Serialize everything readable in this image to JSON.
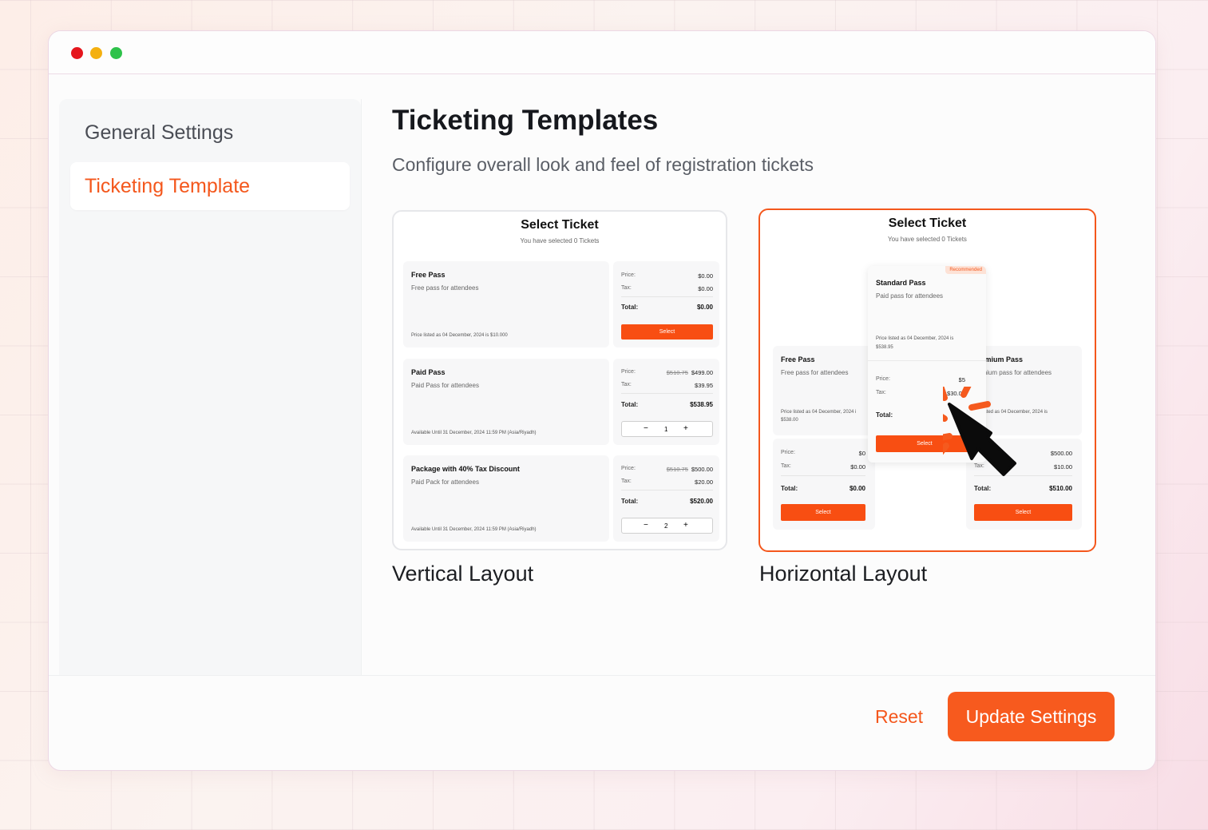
{
  "colors": {
    "accent": "#f4571c",
    "button": "#f75a1e",
    "active_text": "#f4571c"
  },
  "window": {
    "controls": [
      "close",
      "minimize",
      "maximize"
    ]
  },
  "sidebar": {
    "items": [
      {
        "label": "General Settings",
        "active": false
      },
      {
        "label": "Ticketing Template",
        "active": true
      }
    ]
  },
  "main": {
    "title": "Ticketing Templates",
    "subtitle": "Configure overall look and feel of registration tickets"
  },
  "templates": [
    {
      "label": "Vertical Layout",
      "selected": false,
      "preview": {
        "title": "Select Ticket",
        "subtitle": "You have selected 0 Tickets",
        "tickets": [
          {
            "name": "Free Pass",
            "desc": "Free pass for attendees",
            "footer": "Price listed as 04 December, 2024 is $10.000",
            "price_label": "Price:",
            "price": "$0.00",
            "tax_label": "Tax:",
            "tax": "$0.00",
            "total_label": "Total:",
            "total": "$0.00",
            "action": "Select"
          },
          {
            "name": "Paid Pass",
            "desc": "Paid Pass for attendees",
            "footer": "Available Until 31 December, 2024 11:59 PM (Asia/Riyadh)",
            "price_label": "Price:",
            "old_price": "$510.75",
            "price": "$499.00",
            "tax_label": "Tax:",
            "tax": "$39.95",
            "total_label": "Total:",
            "total": "$538.95",
            "qty": "1",
            "minus": "−",
            "plus": "+"
          },
          {
            "name": "Package with 40% Tax Discount",
            "desc": "Paid Pack for attendees",
            "footer": "Available Until 31 December, 2024 11:59 PM (Asia/Riyadh)",
            "price_label": "Price:",
            "old_price": "$510.75",
            "price": "$500.00",
            "tax_label": "Tax:",
            "tax": "$20.00",
            "total_label": "Total:",
            "total": "$520.00",
            "qty": "2",
            "minus": "−",
            "plus": "+"
          }
        ]
      }
    },
    {
      "label": "Horizontal Layout",
      "selected": true,
      "preview": {
        "title": "Select Ticket",
        "subtitle": "You have selected 0 Tickets",
        "standard": {
          "badge": "Recommended",
          "name": "Standard Pass",
          "desc": "Paid pass for attendees",
          "footer_1": "Price listed as 04 December, 2024 is",
          "footer_2": "$538.95",
          "price_label": "Price:",
          "price": "$5",
          "tax_label": "Tax:",
          "tax": "$30.00",
          "total_label": "Total:",
          "action": "Select"
        },
        "free": {
          "name": "Free Pass",
          "desc": "Free pass for attendees",
          "footer_1": "Price listed as 04 December, 2024 i",
          "footer_2": "$538.00",
          "price_label": "Price:",
          "price": "$0",
          "tax_label": "Tax:",
          "tax": "$0.00",
          "total_label": "Total:",
          "total": "$0.00",
          "action": "Select"
        },
        "premium": {
          "name": "remium Pass",
          "desc": "emium pass for attendees",
          "footer_1": "e listed as 04 December, 2024 is",
          "price": "$500.00",
          "tax_label": "Tax:",
          "tax": "$10.00",
          "total_label": "Total:",
          "total": "$510.00",
          "action": "Select"
        }
      }
    }
  ],
  "footer": {
    "reset_label": "Reset",
    "update_label": "Update Settings"
  }
}
